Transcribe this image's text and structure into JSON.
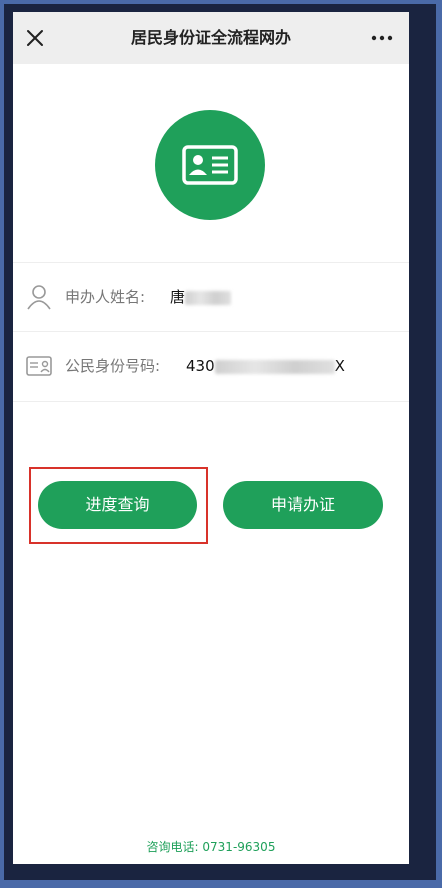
{
  "navbar": {
    "title": "居民身份证全流程网办",
    "close_icon": "close-icon",
    "more_icon": "more-options-icon"
  },
  "hero": {
    "icon": "id-card-icon",
    "color": "#1fa05a"
  },
  "form": {
    "name_label": "申办人姓名:",
    "name_value_visible": "唐",
    "id_label": "公民身份号码:",
    "id_value_prefix": "430",
    "id_value_suffix": "X"
  },
  "actions": {
    "progress_query": "进度查询",
    "apply": "申请办证"
  },
  "footer": {
    "hotline": "咨询电话: 0731-96305"
  },
  "colors": {
    "accent": "#1fa05a",
    "highlight": "#d8322a"
  }
}
